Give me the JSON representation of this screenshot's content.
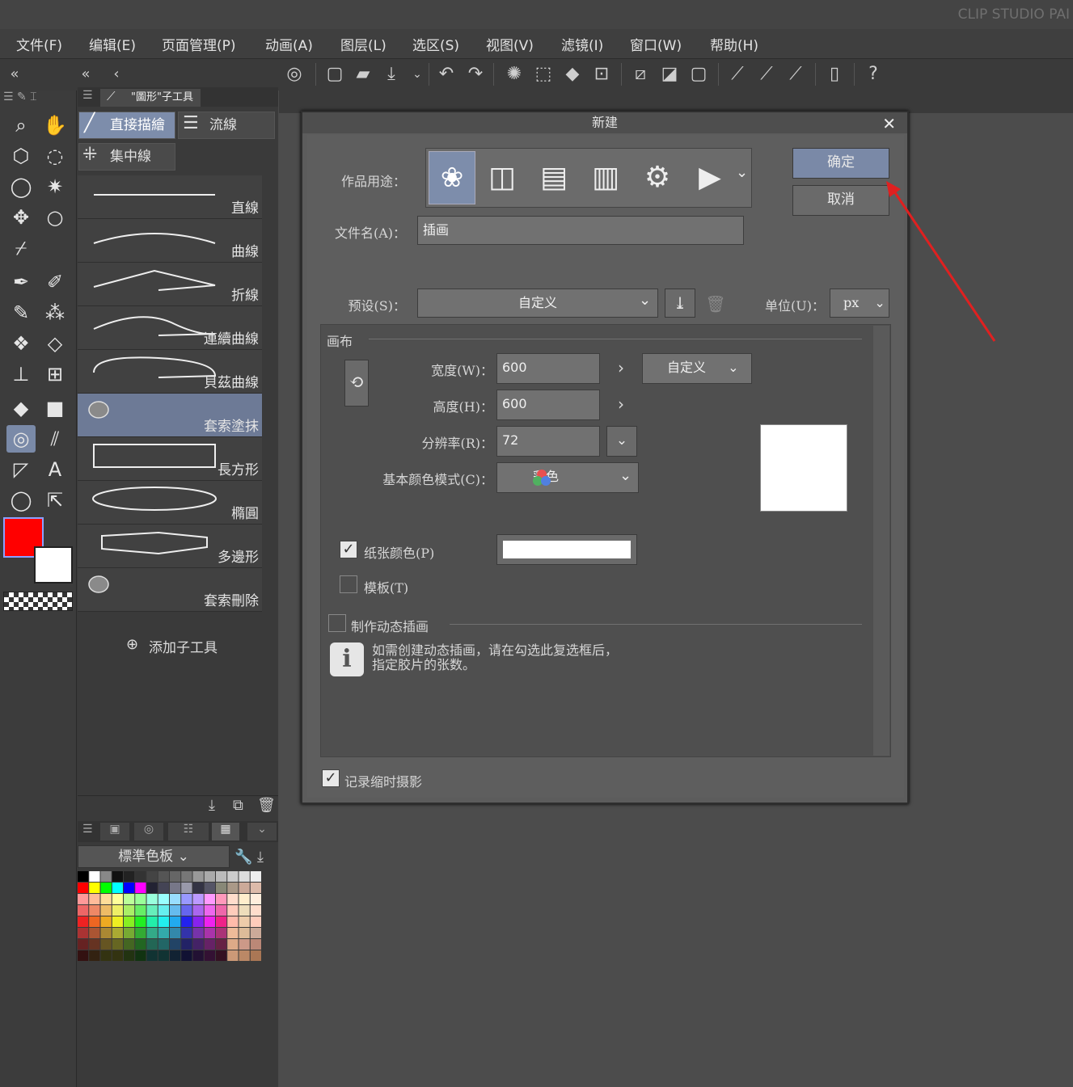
{
  "app": {
    "title": "CLIP STUDIO PAI"
  },
  "menu": [
    "文件(F)",
    "编辑(E)",
    "页面管理(P)",
    "动画(A)",
    "图层(L)",
    "选区(S)",
    "视图(V)",
    "滤镜(I)",
    "窗口(W)",
    "帮助(H)"
  ],
  "subtool_panel": {
    "header": "\"圖形\"子工具",
    "tabs": [
      "直接描繪",
      "流線",
      "集中線"
    ],
    "brushes": [
      "直線",
      "曲線",
      "折線",
      "連續曲線",
      "貝茲曲線",
      "套索塗抹",
      "長方形",
      "橢圓",
      "多邊形",
      "套索刪除"
    ],
    "selected_brush": "套索塗抹",
    "add_label": "添加子工具"
  },
  "colors": {
    "main": "#ff0000",
    "sub": "#ffffff"
  },
  "palette": {
    "name": "標準色板"
  },
  "dialog": {
    "title": "新建",
    "use_label": "作品用途：",
    "filename_label": "文件名(A)：",
    "filename_value": "插画",
    "ok": "确定",
    "cancel": "取消",
    "preset_label": "预设(S)：",
    "preset_value": "自定义",
    "unit_label": "单位(U)：",
    "unit_value": "px",
    "canvas_section": "画布",
    "width_label": "宽度(W)：",
    "width_value": "600",
    "height_label": "高度(H)：",
    "height_value": "600",
    "size_preset": "自定义",
    "resolution_label": "分辨率(R)：",
    "resolution_value": "72",
    "color_mode_label": "基本颜色模式(C)：",
    "color_mode_value": "彩色",
    "paper_color_label": "纸张颜色(P)",
    "template_label": "模板(T)",
    "animation_label": "制作动态插画",
    "info_text_1": "如需创建动态插画，请在勾选此复选框后，",
    "info_text_2": "指定胶片的张数。",
    "timelapse_label": "记录缩时摄影"
  }
}
